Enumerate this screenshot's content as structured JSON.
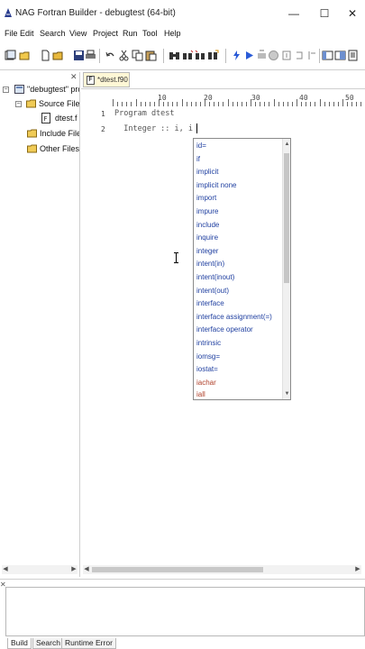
{
  "window": {
    "title": "NAG Fortran Builder - debugtest (64-bit)",
    "minimize": "—",
    "maximize": "☐",
    "close": "✕"
  },
  "menu": [
    "File",
    "Edit",
    "Search",
    "View",
    "Project",
    "Run",
    "Tool",
    "Help"
  ],
  "tree": {
    "project": "\"debugtest\" pro",
    "source_files": "Source File",
    "file": "dtest.f",
    "include_files": "Include File",
    "other_files": "Other Files",
    "expander": "−"
  },
  "editor": {
    "tab_label": "*dtest.f90",
    "tab_icon_letter": "F",
    "ruler": [
      "10",
      "20",
      "30",
      "40",
      "50"
    ],
    "lines": [
      {
        "num": "1",
        "text": "Program dtest"
      },
      {
        "num": "2",
        "text": "  Integer :: i, i"
      }
    ]
  },
  "autocomplete": {
    "items": [
      "id=",
      "if",
      "implicit",
      "implicit none",
      "import",
      "impure",
      "include",
      "inquire",
      "integer",
      "intent(in)",
      "intent(inout)",
      "intent(out)",
      "interface",
      "interface assignment(=)",
      "interface operator",
      "intrinsic",
      "iomsg=",
      "iostat="
    ],
    "more_items": [
      "iachar",
      "iall"
    ],
    "scroll_up": "▲",
    "scroll_down": "▼"
  },
  "scroll": {
    "left": "◀",
    "right": "▶"
  },
  "bottom_tabs": [
    "Build",
    "Search",
    "Runtime Error"
  ]
}
